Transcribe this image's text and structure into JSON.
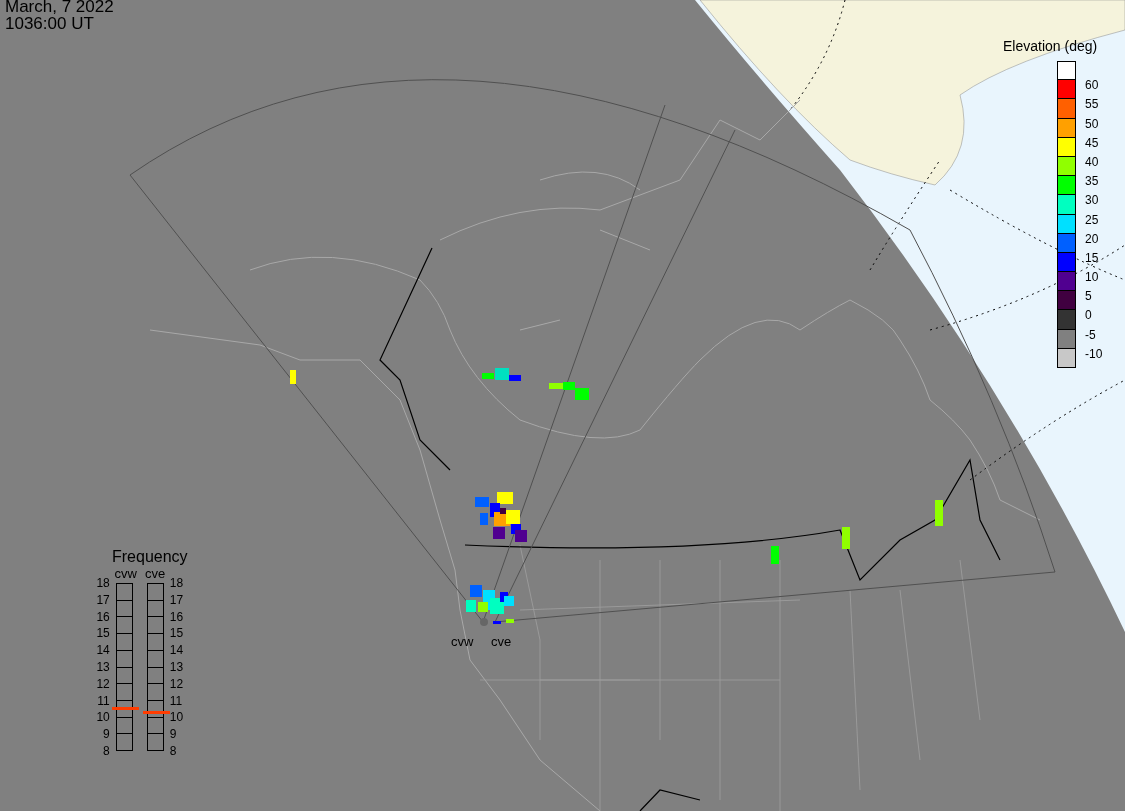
{
  "header": {
    "date": "March, 7 2022",
    "time": "1036:00 UT"
  },
  "map": {
    "sites": [
      {
        "name": "cvw"
      },
      {
        "name": "cve"
      }
    ]
  },
  "elevation_legend": {
    "title": "Elevation (deg)",
    "bins": [
      {
        "color": "#ffffff"
      },
      {
        "color": "#ff0000",
        "label": "60"
      },
      {
        "color": "#ff6000",
        "label": "55"
      },
      {
        "color": "#ffa000",
        "label": "50"
      },
      {
        "color": "#ffff00",
        "label": "45"
      },
      {
        "color": "#90ff00",
        "label": "40"
      },
      {
        "color": "#00ff00",
        "label": "35"
      },
      {
        "color": "#00ffc0",
        "label": "30"
      },
      {
        "color": "#00e0ff",
        "label": "25"
      },
      {
        "color": "#0060ff",
        "label": "20"
      },
      {
        "color": "#0000ff",
        "label": "15"
      },
      {
        "color": "#500090",
        "label": "10"
      },
      {
        "color": "#400040",
        "label": "5"
      },
      {
        "color": "#333333",
        "label": "0"
      },
      {
        "color": "#808080",
        "label": "-5"
      },
      {
        "color": "#c8c8c8",
        "label": "-10"
      }
    ]
  },
  "frequency": {
    "title": "Frequency",
    "radars": [
      {
        "name": "cvw",
        "level": 0.253,
        "scale": [
          "18",
          "17",
          "16",
          "15",
          "14",
          "13",
          "12",
          "11",
          "10",
          "9",
          "8"
        ]
      },
      {
        "name": "cve",
        "level": 0.229,
        "scale": [
          "18",
          "17",
          "16",
          "15",
          "14",
          "13",
          "12",
          "11",
          "10",
          "9",
          "8"
        ]
      }
    ]
  }
}
